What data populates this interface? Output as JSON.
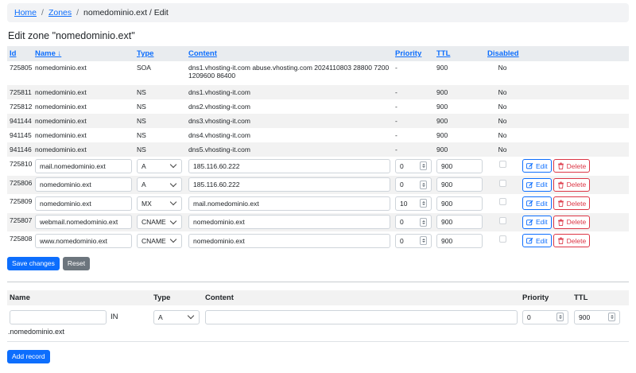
{
  "breadcrumb": {
    "home": "Home",
    "zones": "Zones",
    "current": "nomedominio.ext / Edit"
  },
  "page_title": "Edit zone \"nomedominio.ext\"",
  "columns": {
    "id": "Id",
    "name": "Name ↓",
    "type": "Type",
    "content": "Content",
    "priority": "Priority",
    "ttl": "TTL",
    "disabled": "Disabled"
  },
  "readonly_records": [
    {
      "id": "725805",
      "name": "nomedominio.ext",
      "type": "SOA",
      "content": "dns1.vhosting-it.com abuse.vhosting.com 2024110803 28800 7200 1209600 86400",
      "priority": "-",
      "ttl": "900",
      "disabled": "No"
    },
    {
      "id": "725811",
      "name": "nomedominio.ext",
      "type": "NS",
      "content": "dns1.vhosting-it.com",
      "priority": "-",
      "ttl": "900",
      "disabled": "No"
    },
    {
      "id": "725812",
      "name": "nomedominio.ext",
      "type": "NS",
      "content": "dns2.vhosting-it.com",
      "priority": "-",
      "ttl": "900",
      "disabled": "No"
    },
    {
      "id": "941144",
      "name": "nomedominio.ext",
      "type": "NS",
      "content": "dns3.vhosting-it.com",
      "priority": "-",
      "ttl": "900",
      "disabled": "No"
    },
    {
      "id": "941145",
      "name": "nomedominio.ext",
      "type": "NS",
      "content": "dns4.vhosting-it.com",
      "priority": "-",
      "ttl": "900",
      "disabled": "No"
    },
    {
      "id": "941146",
      "name": "nomedominio.ext",
      "type": "NS",
      "content": "dns5.vhosting-it.com",
      "priority": "-",
      "ttl": "900",
      "disabled": "No"
    }
  ],
  "editable_records": [
    {
      "id": "725810",
      "name": "mail.nomedominio.ext",
      "type": "A",
      "content": "185.116.60.222",
      "priority": "0",
      "ttl": "900",
      "disabled": false
    },
    {
      "id": "725806",
      "name": "nomedominio.ext",
      "type": "A",
      "content": "185.116.60.222",
      "priority": "0",
      "ttl": "900",
      "disabled": false
    },
    {
      "id": "725809",
      "name": "nomedominio.ext",
      "type": "MX",
      "content": "mail.nomedominio.ext",
      "priority": "10",
      "ttl": "900",
      "disabled": false
    },
    {
      "id": "725807",
      "name": "webmail.nomedominio.ext",
      "type": "CNAME",
      "content": "nomedominio.ext",
      "priority": "0",
      "ttl": "900",
      "disabled": false
    },
    {
      "id": "725808",
      "name": "www.nomedominio.ext",
      "type": "CNAME",
      "content": "nomedominio.ext",
      "priority": "0",
      "ttl": "900",
      "disabled": false
    }
  ],
  "row_buttons": {
    "edit": "Edit",
    "delete": "Delete"
  },
  "actions": {
    "save": "Save changes",
    "reset": "Reset"
  },
  "add_form": {
    "headers": {
      "name": "Name",
      "type": "Type",
      "content": "Content",
      "priority": "Priority",
      "ttl": "TTL"
    },
    "name_value": "",
    "in_label": "IN",
    "type_value": "A",
    "content_value": "",
    "priority_value": "0",
    "ttl_value": "900",
    "suffix": ".nomedominio.ext",
    "submit": "Add record"
  },
  "icons": {
    "edit": "pencil-square-icon",
    "delete": "trash-icon",
    "sort": "sort-down-arrow"
  },
  "colors": {
    "primary": "#0d6efd",
    "danger": "#dc3545",
    "secondary": "#6c757d"
  }
}
